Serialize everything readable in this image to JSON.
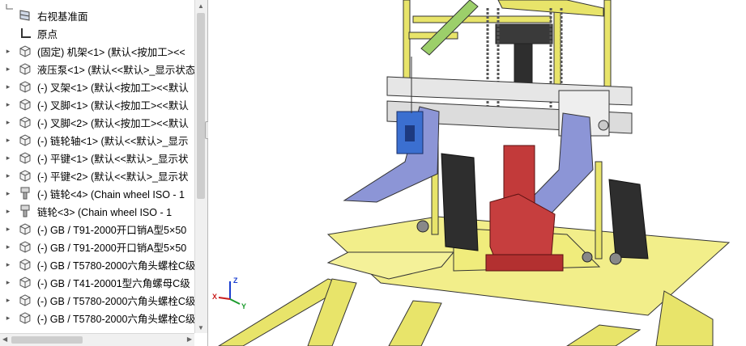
{
  "feature_tree": {
    "items": [
      {
        "label": "右视基准面",
        "icon": "plane-icon",
        "expandable": false
      },
      {
        "label": "原点",
        "icon": "origin-icon",
        "expandable": false
      },
      {
        "label": "(固定) 机架<1> (默认<按加工><<",
        "icon": "part-icon",
        "expandable": true
      },
      {
        "label": "液压泵<1> (默认<<默认>_显示状态",
        "icon": "part-icon",
        "expandable": true
      },
      {
        "label": "(-) 叉架<1> (默认<按加工><<默认",
        "icon": "part-icon",
        "expandable": true
      },
      {
        "label": "(-) 叉脚<1> (默认<按加工><<默认",
        "icon": "part-icon",
        "expandable": true
      },
      {
        "label": "(-) 叉脚<2> (默认<按加工><<默认",
        "icon": "part-icon",
        "expandable": true
      },
      {
        "label": "(-) 链轮轴<1> (默认<<默认>_显示",
        "icon": "part-icon",
        "expandable": true
      },
      {
        "label": "(-) 平键<1> (默认<<默认>_显示状",
        "icon": "part-icon",
        "expandable": true
      },
      {
        "label": "(-) 平键<2> (默认<<默认>_显示状",
        "icon": "part-icon",
        "expandable": true
      },
      {
        "label": "(-) 链轮<4> (Chain wheel ISO - 1",
        "icon": "toolbox-part-icon",
        "expandable": true
      },
      {
        "label": "链轮<3> (Chain wheel ISO - 1",
        "icon": "toolbox-part-icon",
        "expandable": true
      },
      {
        "label": "(-) GB / T91-2000开口销A型5×50",
        "icon": "part-icon",
        "expandable": true
      },
      {
        "label": "(-) GB / T91-2000开口销A型5×50",
        "icon": "part-icon",
        "expandable": true
      },
      {
        "label": "(-) GB / T5780-2000六角头螺栓C级",
        "icon": "part-icon",
        "expandable": true
      },
      {
        "label": "(-) GB / T41-20001型六角螺母C级",
        "icon": "part-icon",
        "expandable": true
      },
      {
        "label": "(-) GB / T5780-2000六角头螺栓C级",
        "icon": "part-icon",
        "expandable": true
      },
      {
        "label": "(-) GB / T5780-2000六角头螺栓C级",
        "icon": "part-icon",
        "expandable": true
      }
    ]
  },
  "triad": {
    "x": "X",
    "y": "Y",
    "z": "Z"
  },
  "colors": {
    "frame": "#e8e46a",
    "pump": "#c23a3a",
    "fork": "#8c95d6",
    "carriage": "#e0e0e0",
    "sidebar_bg": "#ffffff"
  }
}
